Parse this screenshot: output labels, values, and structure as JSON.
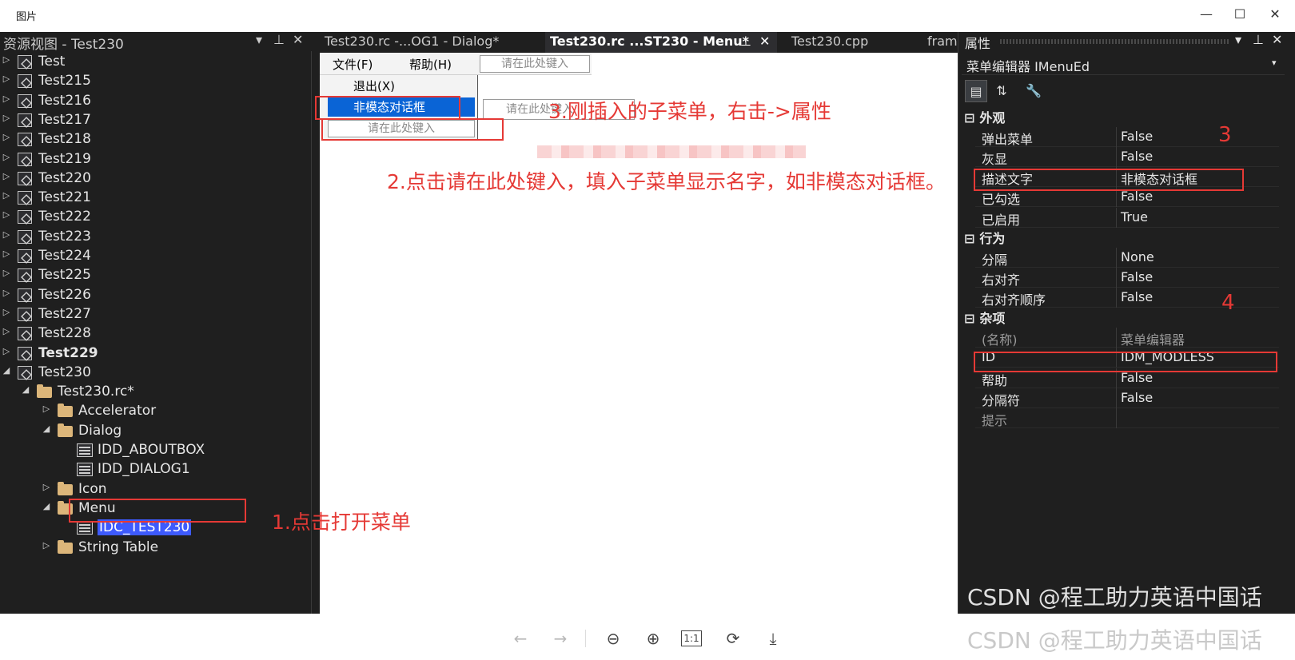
{
  "viewer": {
    "title": "图片",
    "minimize": "—",
    "maximize": "☐",
    "close": "✕"
  },
  "left_panel": {
    "title": "资源视图 - Test230",
    "controls": [
      "▾",
      "⊥",
      "✕"
    ],
    "tree": [
      {
        "label": "Test",
        "kind": "project",
        "level": 0,
        "expanded": false,
        "bold": false
      },
      {
        "label": "Test215",
        "kind": "project",
        "level": 0,
        "expanded": false,
        "bold": false
      },
      {
        "label": "Test216",
        "kind": "project",
        "level": 0,
        "expanded": false,
        "bold": false
      },
      {
        "label": "Test217",
        "kind": "project",
        "level": 0,
        "expanded": false,
        "bold": false
      },
      {
        "label": "Test218",
        "kind": "project",
        "level": 0,
        "expanded": false,
        "bold": false
      },
      {
        "label": "Test219",
        "kind": "project",
        "level": 0,
        "expanded": false,
        "bold": false
      },
      {
        "label": "Test220",
        "kind": "project",
        "level": 0,
        "expanded": false,
        "bold": false
      },
      {
        "label": "Test221",
        "kind": "project",
        "level": 0,
        "expanded": false,
        "bold": false
      },
      {
        "label": "Test222",
        "kind": "project",
        "level": 0,
        "expanded": false,
        "bold": false
      },
      {
        "label": "Test223",
        "kind": "project",
        "level": 0,
        "expanded": false,
        "bold": false
      },
      {
        "label": "Test224",
        "kind": "project",
        "level": 0,
        "expanded": false,
        "bold": false
      },
      {
        "label": "Test225",
        "kind": "project",
        "level": 0,
        "expanded": false,
        "bold": false
      },
      {
        "label": "Test226",
        "kind": "project",
        "level": 0,
        "expanded": false,
        "bold": false
      },
      {
        "label": "Test227",
        "kind": "project",
        "level": 0,
        "expanded": false,
        "bold": false
      },
      {
        "label": "Test228",
        "kind": "project",
        "level": 0,
        "expanded": false,
        "bold": false
      },
      {
        "label": "Test229",
        "kind": "project",
        "level": 0,
        "expanded": false,
        "bold": true
      },
      {
        "label": "Test230",
        "kind": "project",
        "level": 0,
        "expanded": true,
        "bold": false
      },
      {
        "label": "Test230.rc*",
        "kind": "folder-open",
        "level": 1,
        "expanded": true,
        "bold": false
      },
      {
        "label": "Accelerator",
        "kind": "folder",
        "level": 2,
        "expanded": false,
        "bold": false
      },
      {
        "label": "Dialog",
        "kind": "folder-open",
        "level": 2,
        "expanded": true,
        "bold": false
      },
      {
        "label": "IDD_ABOUTBOX",
        "kind": "dialog",
        "level": 3,
        "expanded": null,
        "bold": false
      },
      {
        "label": "IDD_DIALOG1",
        "kind": "dialog",
        "level": 3,
        "expanded": null,
        "bold": false
      },
      {
        "label": "Icon",
        "kind": "folder",
        "level": 2,
        "expanded": false,
        "bold": false
      },
      {
        "label": "Menu",
        "kind": "folder-open",
        "level": 2,
        "expanded": true,
        "bold": false
      },
      {
        "label": "IDC_TEST230",
        "kind": "menu-res",
        "level": 3,
        "expanded": null,
        "bold": false,
        "selected": true
      },
      {
        "label": "String Table",
        "kind": "folder",
        "level": 2,
        "expanded": false,
        "bold": false
      }
    ]
  },
  "center": {
    "tabs": [
      {
        "label": "Test230.rc -...OG1 - Dialog*",
        "active": false
      },
      {
        "label": "Test230.rc ...ST230 - Menu*",
        "active": true,
        "pin": "⊥",
        "close": "✕"
      },
      {
        "label": "Test230.cpp",
        "active": false
      },
      {
        "label": "fram",
        "active": false
      }
    ],
    "menu_bar": {
      "items": [
        "文件(F)",
        "帮助(H)"
      ],
      "type_here": "请在此处键入"
    },
    "dropdown": {
      "items": [
        "退出(X)",
        "非模态对话框",
        "请在此处键入"
      ],
      "submenu_type_here": "请在此处键入"
    },
    "annotations": {
      "step1": "1.点击打开菜单",
      "step2": "2.点击请在此处键入，填入子菜单显示名字，如非模态对话框。",
      "step3": "3.刚插入的子菜单，右击->属性"
    }
  },
  "right_panel": {
    "title": "属性",
    "controls": [
      "▾",
      "⊥",
      "✕"
    ],
    "object": "菜单编辑器  IMenuEd",
    "categories": [
      {
        "name": "外观",
        "props": [
          {
            "name": "弹出菜单",
            "value": "False"
          },
          {
            "name": "灰显",
            "value": "False"
          },
          {
            "name": "描述文字",
            "value": "非模态对话框"
          },
          {
            "name": "已勾选",
            "value": "False"
          },
          {
            "name": "已启用",
            "value": "True"
          }
        ]
      },
      {
        "name": "行为",
        "props": [
          {
            "name": "分隔",
            "value": "None"
          },
          {
            "name": "右对齐",
            "value": "False"
          },
          {
            "name": "右对齐顺序",
            "value": "False"
          }
        ]
      },
      {
        "name": "杂项",
        "props": [
          {
            "name": "(名称)",
            "value": "菜单编辑器"
          },
          {
            "name": "ID",
            "value": "IDM_MODLESS"
          },
          {
            "name": "帮助",
            "value": "False"
          },
          {
            "name": "分隔符",
            "value": "False"
          },
          {
            "name": "提示",
            "value": ""
          }
        ]
      }
    ],
    "annotation_3": "3",
    "annotation_4": "4",
    "watermark": "CSDN @程工助力英语中国话"
  },
  "viewer_toolbar": {
    "buttons": [
      "←",
      "→",
      "⊖",
      "⊕",
      "1:1",
      "⟳",
      "⤓"
    ],
    "watermark": "CSDN @程工助力英语中国话"
  },
  "colors": {
    "accent_red": "#e53935",
    "selection_blue": "#0a64d6",
    "ide_dark": "#1f1f1f"
  }
}
